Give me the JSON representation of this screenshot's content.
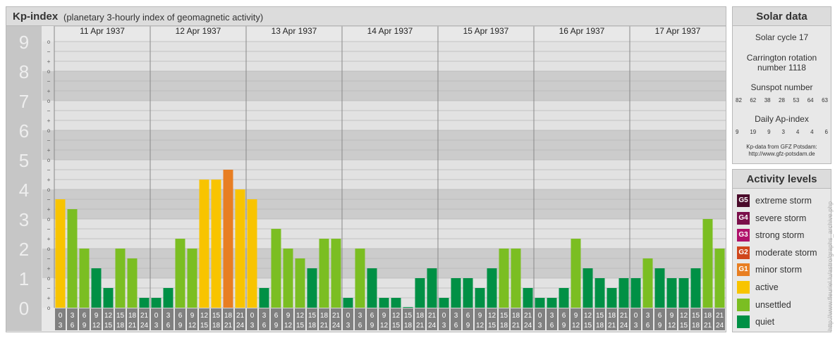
{
  "header": {
    "title": "Kp-index",
    "subtitle": "(planetary 3-hourly index of geomagnetic activity)"
  },
  "chart_data": {
    "type": "bar",
    "y_axis_labels": [
      "0",
      "1",
      "2",
      "3",
      "4",
      "5",
      "6",
      "7",
      "8",
      "9"
    ],
    "ylim": [
      0,
      9
    ],
    "minor_tick_symbols": [
      "o",
      "+",
      "−"
    ],
    "days": [
      "11 Apr 1937",
      "12 Apr 1937",
      "13 Apr 1937",
      "14 Apr 1937",
      "15 Apr 1937",
      "16 Apr 1937",
      "17 Apr 1937"
    ],
    "interval_start_hours": [
      "0",
      "3",
      "6",
      "9",
      "12",
      "15",
      "18",
      "21"
    ],
    "interval_end_hours": [
      "3",
      "6",
      "9",
      "12",
      "15",
      "18",
      "21",
      "24"
    ],
    "values": [
      [
        3.667,
        3.333,
        2.0,
        1.333,
        0.667,
        2.0,
        1.667,
        0.333
      ],
      [
        0.333,
        0.667,
        2.333,
        2.0,
        4.333,
        4.333,
        4.667,
        4.0
      ],
      [
        3.667,
        0.667,
        2.667,
        2.0,
        1.667,
        1.333,
        2.333,
        2.333
      ],
      [
        0.333,
        2.0,
        1.333,
        0.333,
        0.333,
        0.0,
        1.0,
        1.333
      ],
      [
        0.333,
        1.0,
        1.0,
        0.667,
        1.333,
        2.0,
        2.0,
        0.667
      ],
      [
        0.333,
        0.333,
        0.667,
        2.333,
        1.333,
        1.0,
        0.667,
        1.0
      ],
      [
        1.0,
        1.667,
        1.333,
        1.0,
        1.0,
        1.333,
        3.0,
        2.0
      ]
    ],
    "colors": {
      "quiet": "#009045",
      "unsettled": "#7bbe22",
      "active": "#f8c400",
      "minor_storm": "#e87e22"
    }
  },
  "solar": {
    "title": "Solar data",
    "cycle": "Solar cycle 17",
    "carrington_line1": "Carrington rotation",
    "carrington_line2": "number 1118",
    "sunspot_title": "Sunspot number",
    "sunspot_values": [
      "82",
      "62",
      "38",
      "28",
      "53",
      "64",
      "63"
    ],
    "ap_title": "Daily Ap-index",
    "ap_values": [
      "9",
      "19",
      "9",
      "3",
      "4",
      "4",
      "6"
    ],
    "source_line1": "Kp-data from GFZ Potsdam:",
    "source_line2": "http://www.gfz-potsdam.de"
  },
  "levels": {
    "title": "Activity levels",
    "items": [
      {
        "code": "G5",
        "label": "extreme storm",
        "color": "#4a0b2a"
      },
      {
        "code": "G4",
        "label": "severe storm",
        "color": "#7a0f4a"
      },
      {
        "code": "G3",
        "label": "strong storm",
        "color": "#b0106a"
      },
      {
        "code": "G2",
        "label": "moderate storm",
        "color": "#d0461c"
      },
      {
        "code": "G1",
        "label": "minor storm",
        "color": "#e87e22"
      },
      {
        "code": "",
        "label": "active",
        "color": "#f8c400"
      },
      {
        "code": "",
        "label": "unsettled",
        "color": "#7bbe22"
      },
      {
        "code": "",
        "label": "quiet",
        "color": "#009045"
      }
    ]
  },
  "watermark": "http://www.fleuriel.lu/astro/graphs_archive.php"
}
